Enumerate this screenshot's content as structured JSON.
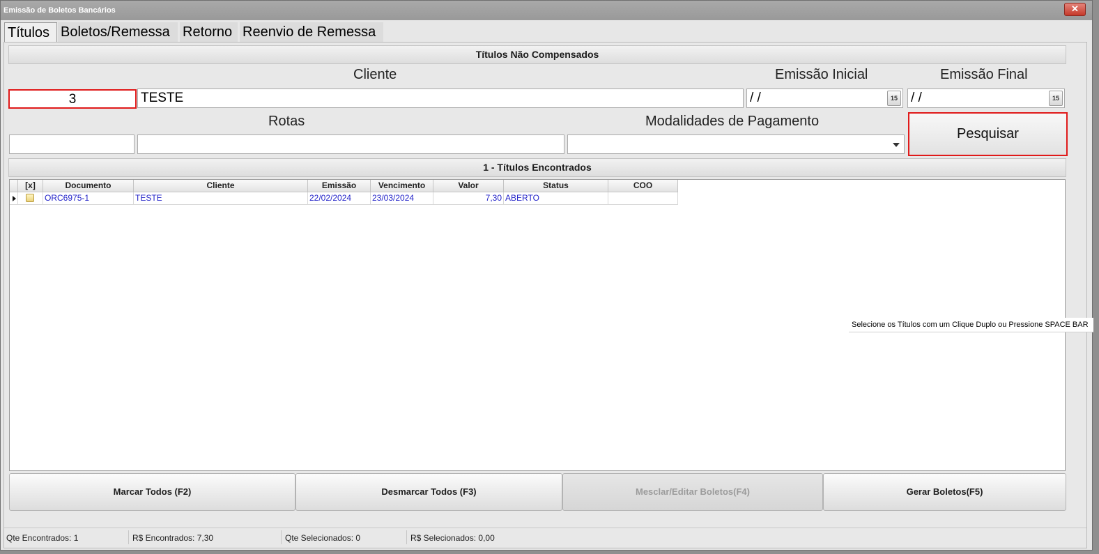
{
  "window": {
    "title": "Emissão de Boletos Bancários",
    "close_label": "✕"
  },
  "tabs": [
    {
      "label": "Títulos"
    },
    {
      "label": "Boletos/Remessa"
    },
    {
      "label": "Retorno"
    },
    {
      "label": "Reenvio de Remessa"
    }
  ],
  "filters": {
    "section_title": "Títulos Não Compensados",
    "cliente_label": "Cliente",
    "cliente_code": "3",
    "cliente_name": "TESTE",
    "emissao_inicial_label": "Emissão Inicial",
    "emissao_inicial_value": " /  /",
    "emissao_final_label": "Emissão Final",
    "emissao_final_value": " /  /",
    "calendar_icon_label": "15",
    "rotas_label": "Rotas",
    "rotas_code": "",
    "rotas_name": "",
    "modalidades_label": "Modalidades de Pagamento",
    "modalidades_value": "",
    "pesquisar_label": "Pesquisar"
  },
  "results": {
    "section_title": "1 - Títulos Encontrados",
    "columns": [
      "",
      "[x]",
      "Documento",
      "Cliente",
      "Emissão",
      "Vencimento",
      "Valor",
      "Status",
      "COO"
    ],
    "rows": [
      {
        "documento": "ORC6975-1",
        "cliente": "TESTE",
        "emissao": "22/02/2024",
        "vencimento": "23/03/2024",
        "valor": "7,30",
        "status": "ABERTO",
        "coo": ""
      }
    ],
    "tooltip": "Selecione os Títulos com um Clique Duplo ou Pressione SPACE BAR"
  },
  "actions": {
    "marcar": "Marcar Todos (F2)",
    "desmarcar": "Desmarcar Todos (F3)",
    "mesclar": "Mesclar/Editar Boletos(F4)",
    "gerar": "Gerar Boletos(F5)"
  },
  "status": {
    "qte_encontrados": "Qte Encontrados: 1",
    "rs_encontrados": "R$ Encontrados: 7,30",
    "qte_selecionados": "Qte Selecionados: 0",
    "rs_selecionados": "R$ Selecionados: 0,00"
  },
  "colors": {
    "highlight_red": "#e01a1a",
    "grid_text_blue": "#2323c9"
  }
}
